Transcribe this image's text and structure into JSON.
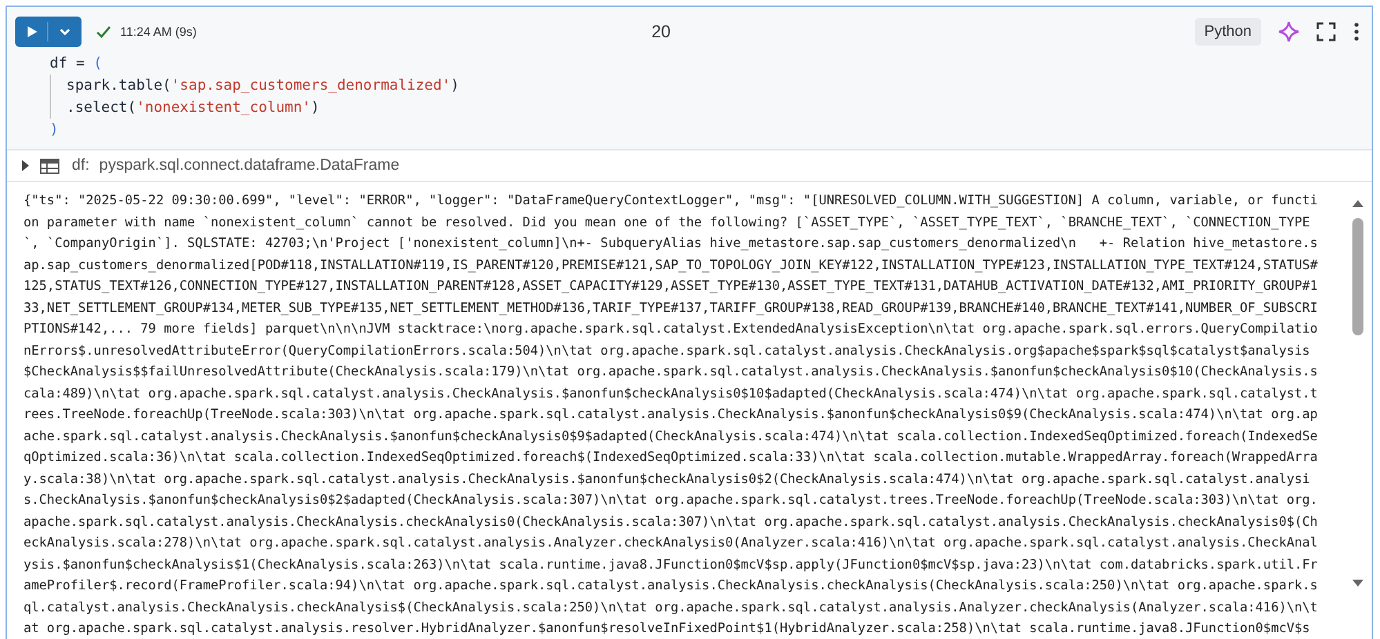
{
  "cell": {
    "run_button": {
      "expanded": false
    },
    "succeeded": true,
    "run_time": "11:24 AM (9s)",
    "cell_number": "20",
    "language": "Python"
  },
  "code": [
    {
      "indented": false,
      "tokens": [
        {
          "kind": "plain",
          "text": "df = "
        },
        {
          "kind": "paren",
          "text": "("
        }
      ]
    },
    {
      "indented": true,
      "tokens": [
        {
          "kind": "plain",
          "text": "spark.table("
        },
        {
          "kind": "string",
          "text": "'sap.sap_customers_denormalized'"
        },
        {
          "kind": "plain",
          "text": ")"
        }
      ]
    },
    {
      "indented": true,
      "tokens": [
        {
          "kind": "plain",
          "text": ".select("
        },
        {
          "kind": "string",
          "text": "'nonexistent_column'"
        },
        {
          "kind": "plain",
          "text": ")"
        }
      ]
    },
    {
      "indented": false,
      "tokens": [
        {
          "kind": "paren",
          "text": ")"
        }
      ]
    }
  ],
  "result": {
    "expanded": false,
    "name": "df:",
    "type": "pyspark.sql.connect.dataframe.DataFrame"
  },
  "log_lines": [
    "{\"ts\": \"2025-05-22 09:30:00.699\", \"level\": \"ERROR\", \"logger\": \"DataFrameQueryContextLogger\", \"msg\": \"[UNRESOLVED_COLUMN.WITH_SUGGESTION] A column, variable, or functi",
    "on parameter with name `nonexistent_column` cannot be resolved. Did you mean one of the following? [`ASSET_TYPE`, `ASSET_TYPE_TEXT`, `BRANCHE_TEXT`, `CONNECTION_TYPE",
    "`, `CompanyOrigin`]. SQLSTATE: 42703;\\n'Project ['nonexistent_column]\\n+- SubqueryAlias hive_metastore.sap.sap_customers_denormalized\\n   +- Relation hive_metastore.s",
    "ap.sap_customers_denormalized[POD#118,INSTALLATION#119,IS_PARENT#120,PREMISE#121,SAP_TO_TOPOLOGY_JOIN_KEY#122,INSTALLATION_TYPE#123,INSTALLATION_TYPE_TEXT#124,STATUS#",
    "125,STATUS_TEXT#126,CONNECTION_TYPE#127,INSTALLATION_PARENT#128,ASSET_CAPACITY#129,ASSET_TYPE#130,ASSET_TYPE_TEXT#131,DATAHUB_ACTIVATION_DATE#132,AMI_PRIORITY_GROUP#1",
    "33,NET_SETTLEMENT_GROUP#134,METER_SUB_TYPE#135,NET_SETTLEMENT_METHOD#136,TARIF_TYPE#137,TARIFF_GROUP#138,READ_GROUP#139,BRANCHE#140,BRANCHE_TEXT#141,NUMBER_OF_SUBSCRI",
    "PTIONS#142,... 79 more fields] parquet\\n\\n\\nJVM stacktrace:\\norg.apache.spark.sql.catalyst.ExtendedAnalysisException\\n\\tat org.apache.spark.sql.errors.QueryCompilatio",
    "nErrors$.unresolvedAttributeError(QueryCompilationErrors.scala:504)\\n\\tat org.apache.spark.sql.catalyst.analysis.CheckAnalysis.org$apache$spark$sql$catalyst$analysis",
    "$CheckAnalysis$$failUnresolvedAttribute(CheckAnalysis.scala:179)\\n\\tat org.apache.spark.sql.catalyst.analysis.CheckAnalysis.$anonfun$checkAnalysis0$10(CheckAnalysis.s",
    "cala:489)\\n\\tat org.apache.spark.sql.catalyst.analysis.CheckAnalysis.$anonfun$checkAnalysis0$10$adapted(CheckAnalysis.scala:474)\\n\\tat org.apache.spark.sql.catalyst.t",
    "rees.TreeNode.foreachUp(TreeNode.scala:303)\\n\\tat org.apache.spark.sql.catalyst.analysis.CheckAnalysis.$anonfun$checkAnalysis0$9(CheckAnalysis.scala:474)\\n\\tat org.ap",
    "ache.spark.sql.catalyst.analysis.CheckAnalysis.$anonfun$checkAnalysis0$9$adapted(CheckAnalysis.scala:474)\\n\\tat scala.collection.IndexedSeqOptimized.foreach(IndexedSe",
    "qOptimized.scala:36)\\n\\tat scala.collection.IndexedSeqOptimized.foreach$(IndexedSeqOptimized.scala:33)\\n\\tat scala.collection.mutable.WrappedArray.foreach(WrappedArra",
    "y.scala:38)\\n\\tat org.apache.spark.sql.catalyst.analysis.CheckAnalysis.$anonfun$checkAnalysis0$2(CheckAnalysis.scala:474)\\n\\tat org.apache.spark.sql.catalyst.analysi",
    "s.CheckAnalysis.$anonfun$checkAnalysis0$2$adapted(CheckAnalysis.scala:307)\\n\\tat org.apache.spark.sql.catalyst.trees.TreeNode.foreachUp(TreeNode.scala:303)\\n\\tat org.",
    "apache.spark.sql.catalyst.analysis.CheckAnalysis.checkAnalysis0(CheckAnalysis.scala:307)\\n\\tat org.apache.spark.sql.catalyst.analysis.CheckAnalysis.checkAnalysis0$(Ch",
    "eckAnalysis.scala:278)\\n\\tat org.apache.spark.sql.catalyst.analysis.Analyzer.checkAnalysis0(Analyzer.scala:416)\\n\\tat org.apache.spark.sql.catalyst.analysis.CheckAnal",
    "ysis.$anonfun$checkAnalysis$1(CheckAnalysis.scala:263)\\n\\tat scala.runtime.java8.JFunction0$mcV$sp.apply(JFunction0$mcV$sp.java:23)\\n\\tat com.databricks.spark.util.Fr",
    "ameProfiler$.record(FrameProfiler.scala:94)\\n\\tat org.apache.spark.sql.catalyst.analysis.CheckAnalysis.checkAnalysis(CheckAnalysis.scala:250)\\n\\tat org.apache.spark.s",
    "ql.catalyst.analysis.CheckAnalysis.checkAnalysis$(CheckAnalysis.scala:250)\\n\\tat org.apache.spark.sql.catalyst.analysis.Analyzer.checkAnalysis(Analyzer.scala:416)\\n\\t",
    "at org.apache.spark.sql.catalyst.analysis.resolver.HybridAnalyzer.$anonfun$resolveInFixedPoint$1(HybridAnalyzer.scala:258)\\n\\tat scala.runtime.java8.JFunction0$mcV$s"
  ]
}
